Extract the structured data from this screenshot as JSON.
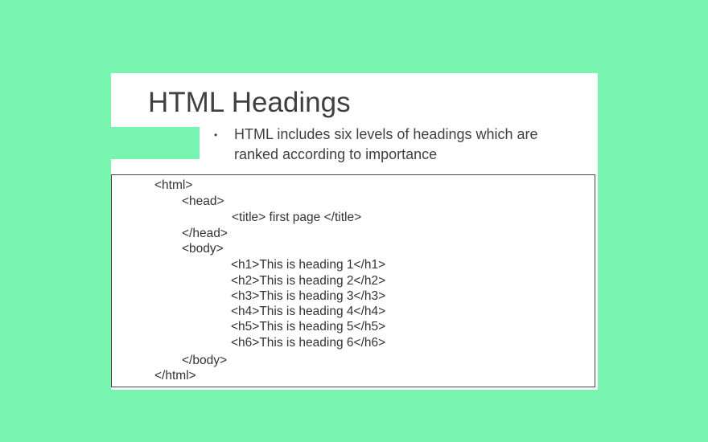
{
  "slide": {
    "title": "HTML Headings",
    "bullets": [
      "HTML includes six levels of headings which are ranked according to importance"
    ],
    "bullet_marker": "•"
  },
  "code": {
    "lines": [
      "<html>",
      "<head>",
      "<title> first page </title>",
      "</head>",
      "<body>",
      "<h1>This is heading 1</h1>",
      "<h2>This is heading 2</h2>",
      "<h3>This is heading 3</h3>",
      "<h4>This is heading 4</h4>",
      "<h5>This is heading 5</h5>",
      "<h6>This is heading 6</h6>",
      "</body>",
      "</html>"
    ]
  },
  "colors": {
    "background": "#77f5ae",
    "slide": "#ffffff",
    "text": "#404040"
  }
}
